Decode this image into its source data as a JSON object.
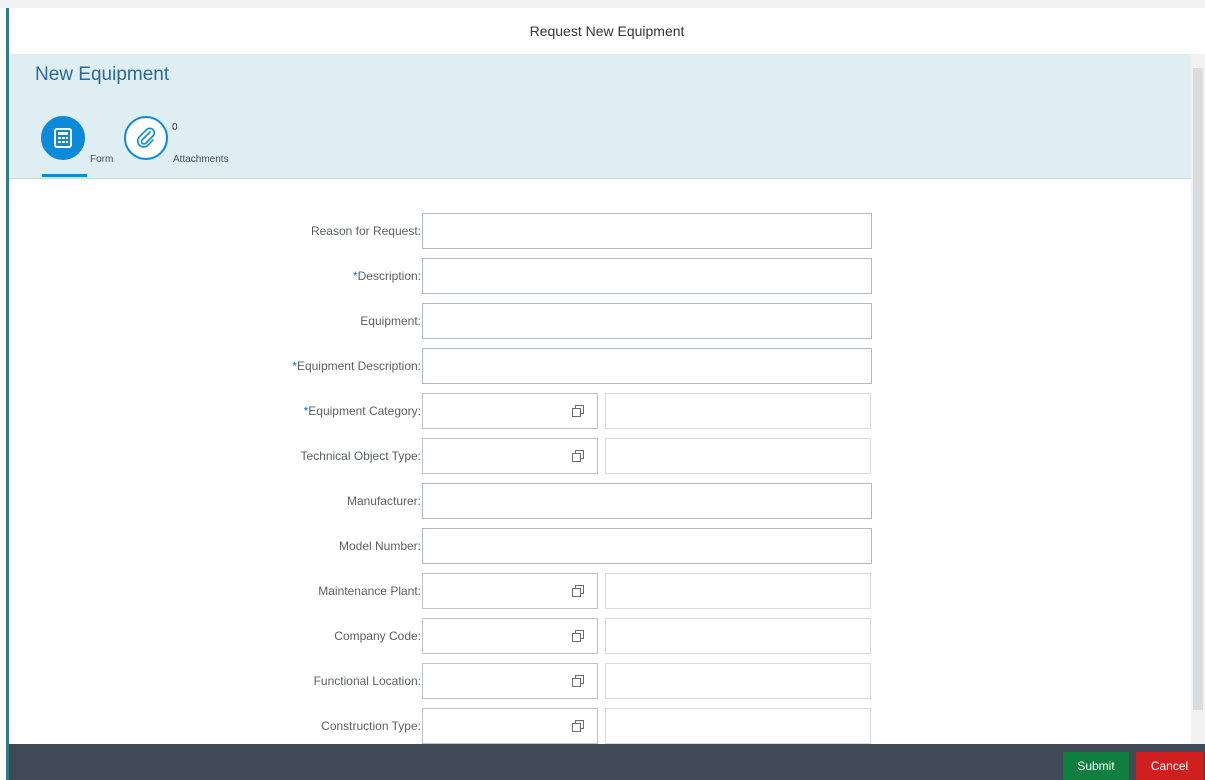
{
  "dialog": {
    "title": "Request New Equipment"
  },
  "header": {
    "title": "New Equipment",
    "tabs": [
      {
        "label": "Form",
        "icon": "form-icon"
      },
      {
        "label": "Attachments",
        "count": "0",
        "icon": "paperclip-icon"
      }
    ]
  },
  "form": {
    "fields": [
      {
        "label": "Reason for Request:",
        "required": false,
        "type": "text",
        "value": ""
      },
      {
        "label": "Description:",
        "required": true,
        "type": "text",
        "value": ""
      },
      {
        "label": "Equipment:",
        "required": false,
        "type": "text",
        "value": ""
      },
      {
        "label": "Equipment Description:",
        "required": true,
        "type": "text",
        "value": ""
      },
      {
        "label": "Equipment Category:",
        "required": true,
        "type": "value-help",
        "value": "",
        "description": ""
      },
      {
        "label": "Technical Object Type:",
        "required": false,
        "type": "value-help",
        "value": "",
        "description": ""
      },
      {
        "label": "Manufacturer:",
        "required": false,
        "type": "text",
        "value": ""
      },
      {
        "label": "Model Number:",
        "required": false,
        "type": "text",
        "value": ""
      },
      {
        "label": "Maintenance Plant:",
        "required": false,
        "type": "value-help",
        "value": "",
        "description": ""
      },
      {
        "label": "Company Code:",
        "required": false,
        "type": "value-help",
        "value": "",
        "description": ""
      },
      {
        "label": "Functional Location:",
        "required": false,
        "type": "value-help",
        "value": "",
        "description": ""
      },
      {
        "label": "Construction Type:",
        "required": false,
        "type": "value-help",
        "value": "",
        "description": ""
      }
    ],
    "required_marker": "*"
  },
  "footer": {
    "submit_label": "Submit",
    "cancel_label": "Cancel"
  },
  "colors": {
    "accent": "#0a8ad8",
    "header_bg": "#dfeef2",
    "title_text": "#2a6a9b",
    "footer_bg": "#3f4a55",
    "submit_bg": "#107e3e",
    "cancel_bg": "#d01f1f",
    "required": "#0a6fd1"
  }
}
